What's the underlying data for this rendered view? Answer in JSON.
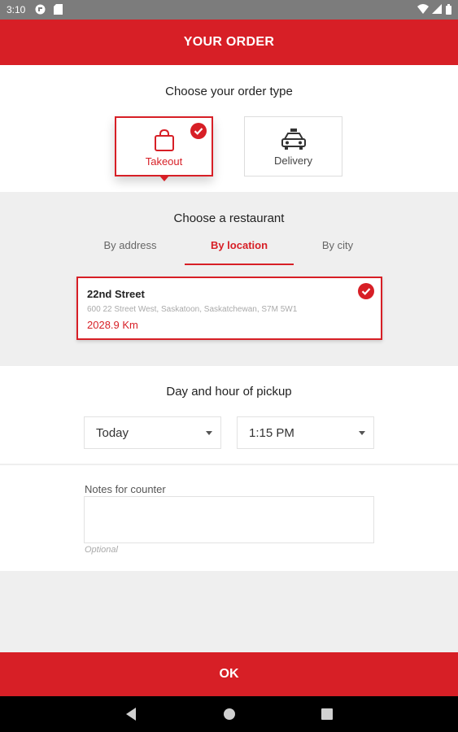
{
  "status_bar": {
    "time": "3:10",
    "left_icons": [
      "circle-status-icon",
      "sd-card-icon"
    ],
    "right_icons": [
      "wifi-icon",
      "signal-icon",
      "battery-icon"
    ]
  },
  "header": {
    "title": "YOUR ORDER"
  },
  "order_type": {
    "title": "Choose your order type",
    "options": [
      {
        "label": "Takeout",
        "icon": "shopping-bag-icon",
        "selected": true
      },
      {
        "label": "Delivery",
        "icon": "car-icon",
        "selected": false
      }
    ]
  },
  "restaurant": {
    "title": "Choose a restaurant",
    "tabs": [
      {
        "label": "By address",
        "active": false
      },
      {
        "label": "By location",
        "active": true
      },
      {
        "label": "By city",
        "active": false
      }
    ],
    "selected": {
      "name": "22nd Street",
      "address": "600 22 Street West, Saskatoon, Saskatchewan, S7M 5W1",
      "distance": "2028.9 Km"
    }
  },
  "pickup": {
    "title": "Day and hour of pickup",
    "day": "Today",
    "time": "1:15 PM"
  },
  "notes": {
    "label": "Notes for counter",
    "value": "",
    "hint": "Optional"
  },
  "footer": {
    "ok_label": "OK"
  },
  "colors": {
    "accent": "#d71f26",
    "background": "#efefef",
    "status_bar": "#7c7c7c"
  }
}
